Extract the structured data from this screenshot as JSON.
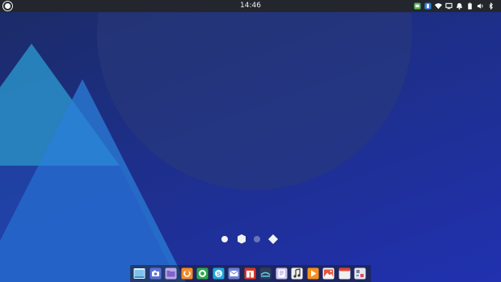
{
  "panel": {
    "clock": "14:46",
    "menu_icon": "app-menu-icon",
    "tray_icons": [
      {
        "name": "messenger-icon",
        "color": "#5cb85c"
      },
      {
        "name": "dropbox-icon",
        "color": "#2f7fe0"
      },
      {
        "name": "wifi-icon",
        "color": "#ffffff"
      },
      {
        "name": "monitor-icon",
        "color": "#ffffff"
      },
      {
        "name": "notifications-icon",
        "color": "#ffffff"
      },
      {
        "name": "battery-icon",
        "color": "#ffffff"
      },
      {
        "name": "volume-icon",
        "color": "#ffffff"
      },
      {
        "name": "bluetooth-icon",
        "color": "#ffffff"
      },
      {
        "name": "power-icon",
        "color": "#ffffff"
      },
      {
        "name": "show-desktop-icon",
        "color": "#ffffff"
      }
    ]
  },
  "workspaces": {
    "items": [
      "circle",
      "hexagon",
      "circle",
      "diamond"
    ],
    "active_index": 1
  },
  "dock": {
    "items": [
      {
        "name": "dock-item-file-manager",
        "icon": "folder-window-icon",
        "color": "#7fc3ec"
      },
      {
        "name": "dock-item-screenshot",
        "icon": "camera-icon",
        "color": "#5b6fd6"
      },
      {
        "name": "dock-item-files",
        "icon": "folder-icon",
        "color": "#9b7fd6"
      },
      {
        "name": "dock-item-firefox",
        "icon": "firefox-icon",
        "color": "#f58a2a"
      },
      {
        "name": "dock-item-browser",
        "icon": "chrome-icon",
        "color": "#2fa84f"
      },
      {
        "name": "dock-item-skype",
        "icon": "skype-icon",
        "color": "#1fa7e0"
      },
      {
        "name": "dock-item-mail",
        "icon": "mail-icon",
        "color": "#6c7fd6"
      },
      {
        "name": "dock-item-app-center",
        "icon": "gift-icon",
        "color": "#d63a2a"
      },
      {
        "name": "dock-item-terminal",
        "icon": "terminal-icon",
        "color": "#2c3e5a"
      },
      {
        "name": "dock-item-text-editor",
        "icon": "document-icon",
        "color": "#c9c3f0"
      },
      {
        "name": "dock-item-music",
        "icon": "music-note-icon",
        "color": "#f0f0f0"
      },
      {
        "name": "dock-item-video",
        "icon": "play-icon",
        "color": "#f5901e"
      },
      {
        "name": "dock-item-photos",
        "icon": "photo-icon",
        "color": "#e8533a"
      },
      {
        "name": "dock-item-calendar",
        "icon": "calendar-icon",
        "color": "#f0f0f0"
      },
      {
        "name": "dock-item-settings",
        "icon": "settings-icon",
        "color": "#e6e6ea"
      }
    ]
  }
}
